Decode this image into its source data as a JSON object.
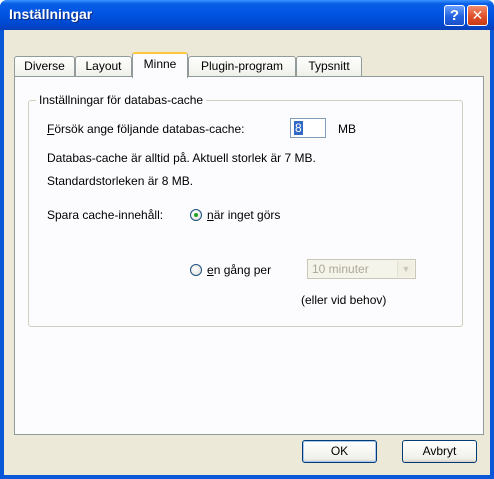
{
  "window": {
    "title": "Inställningar",
    "help_label": "?",
    "close_label": "✕"
  },
  "tabs": [
    {
      "label": "Diverse",
      "active": false
    },
    {
      "label": "Layout",
      "active": false
    },
    {
      "label": "Minne",
      "active": true
    },
    {
      "label": "Plugin-program",
      "active": false
    },
    {
      "label": "Typsnitt",
      "active": false
    }
  ],
  "group": {
    "title": "Inställningar för databas-cache",
    "cache_label_first": "F",
    "cache_label_rest": "örsök ange följande databas-cache:",
    "cache_value": "8",
    "cache_unit": "MB",
    "info_line1": "Databas-cache är alltid på.  Aktuell storlek är 7 MB.",
    "info_line2": "Standardstorleken är 8 MB.",
    "save_label": "Spara cache-innehåll:",
    "radio_idle_first": "n",
    "radio_idle_rest": "är inget görs",
    "radio_interval_first": "e",
    "radio_interval_rest": "n gång per",
    "interval_value": "10 minuter",
    "on_demand_note": "(eller vid behov)"
  },
  "buttons": {
    "ok": "OK",
    "cancel": "Avbryt"
  },
  "colors": {
    "titlebar": "#0054e3",
    "dialog_bg": "#ece9d8",
    "panel_bg": "#fcfcfe",
    "active_tab_accent": "#ffc83c"
  }
}
